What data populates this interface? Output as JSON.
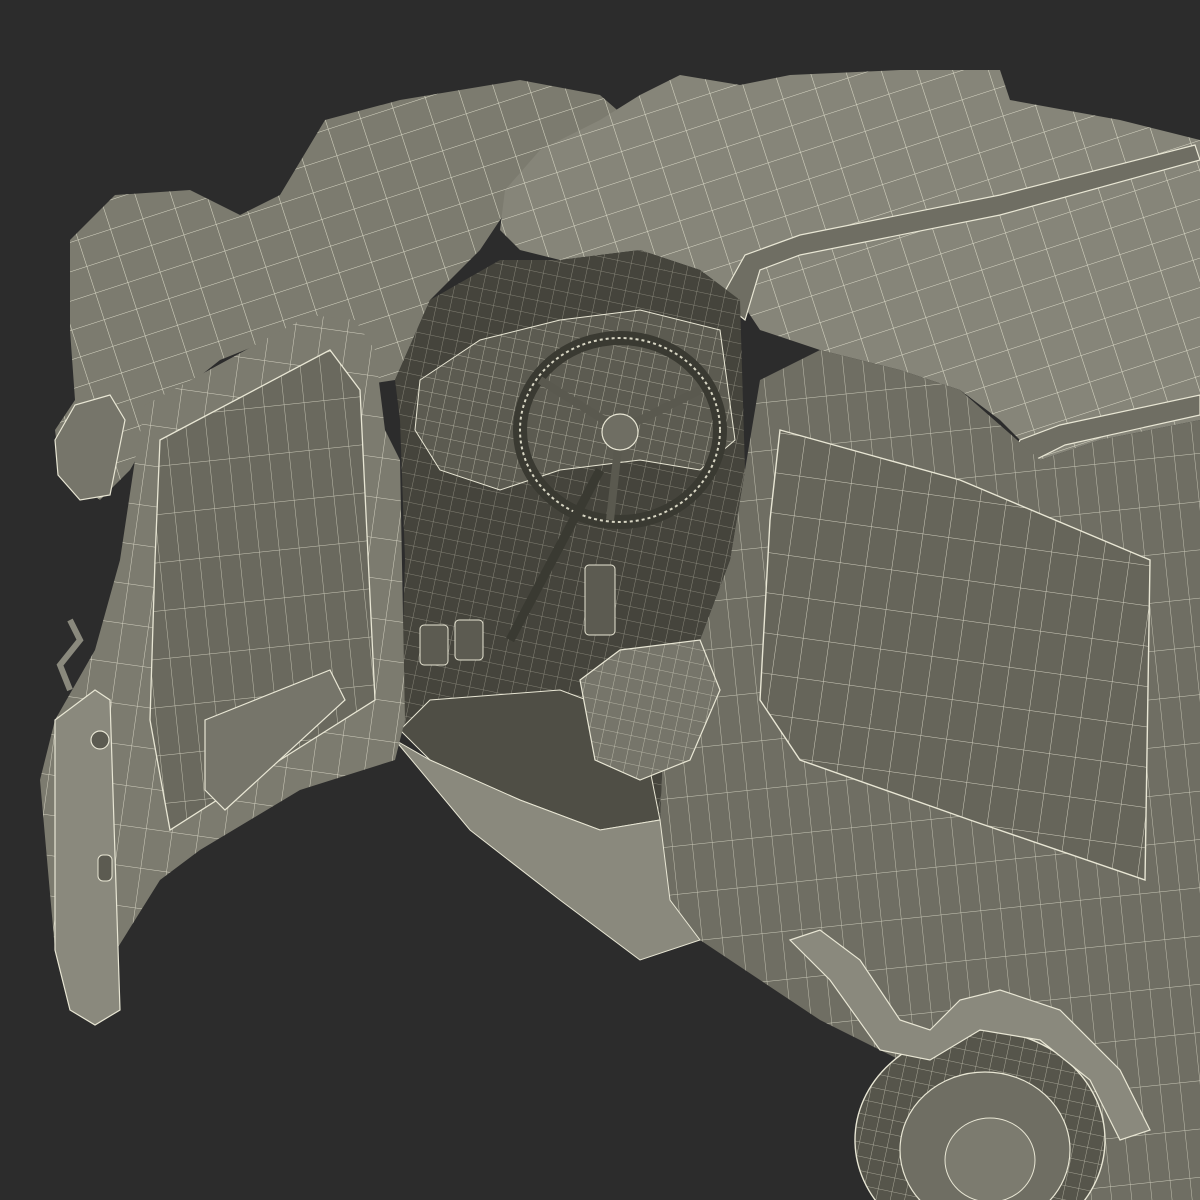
{
  "scene": {
    "subject": "wireframe-vehicle-render",
    "background_color": "#2c2c2c",
    "surface_color": "#7c7b6f",
    "surface_light_color": "#8f8e82",
    "surface_dark_color": "#56554b",
    "interior_color": "#3d3d35",
    "wire_color": "#e8e6d4"
  }
}
